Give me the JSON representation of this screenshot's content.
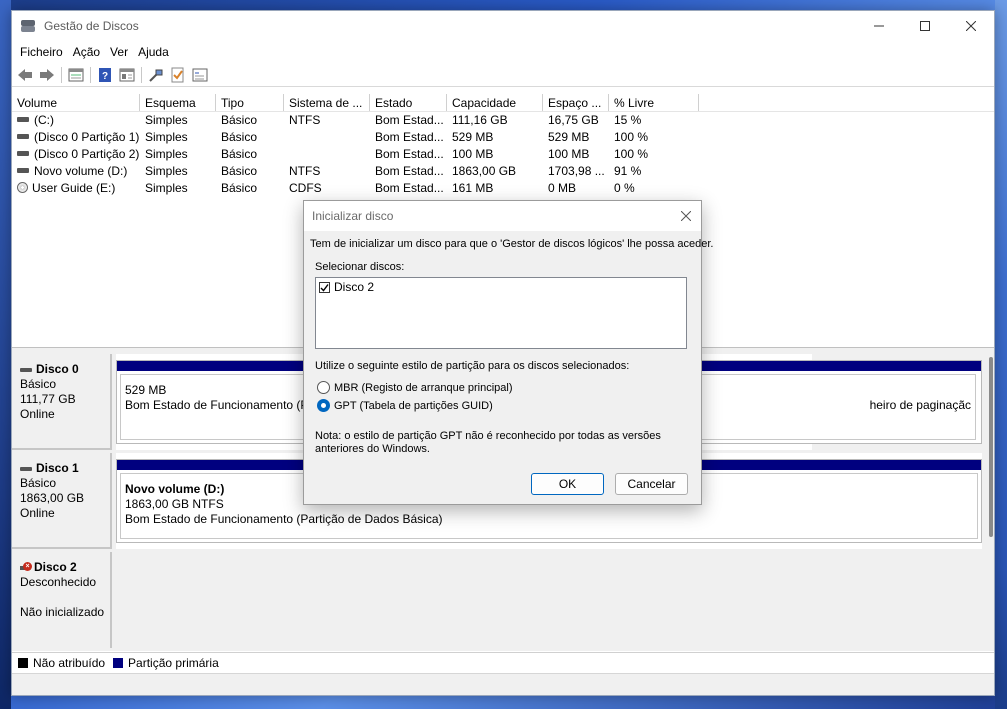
{
  "window": {
    "title": "Gestão de Discos"
  },
  "menu": [
    "Ficheiro",
    "Ação",
    "Ver",
    "Ajuda"
  ],
  "toolbar": {
    "icons": [
      "back-icon",
      "forward-icon",
      "disk-list-icon",
      "help-icon",
      "properties-icon",
      "connect-icon",
      "check-icon",
      "console-icon"
    ]
  },
  "volume_list": {
    "columns": [
      "Volume",
      "Esquema",
      "Tipo",
      "Sistema de ...",
      "Estado",
      "Capacidade",
      "Espaço ...",
      "% Livre"
    ],
    "rows": [
      [
        "(C:)",
        "Simples",
        "Básico",
        "NTFS",
        "Bom Estad...",
        "111,16 GB",
        "16,75 GB",
        "15 %"
      ],
      [
        "(Disco 0 Partição 1)",
        "Simples",
        "Básico",
        "",
        "Bom Estad...",
        "529 MB",
        "529 MB",
        "100 %"
      ],
      [
        "(Disco 0 Partição 2)",
        "Simples",
        "Básico",
        "",
        "Bom Estad...",
        "100 MB",
        "100 MB",
        "100 %"
      ],
      [
        "Novo volume (D:)",
        "Simples",
        "Básico",
        "NTFS",
        "Bom Estad...",
        "1863,00 GB",
        "1703,98 ...",
        "91 %"
      ],
      [
        "User Guide (E:)",
        "Simples",
        "Básico",
        "CDFS",
        "Bom Estad...",
        "161 MB",
        "0 MB",
        "0 %"
      ]
    ]
  },
  "disks": [
    {
      "name": "Disco 0",
      "type": "Básico",
      "size": "111,77 GB",
      "status": "Online",
      "partitions": [
        {
          "line1": "529 MB",
          "line2": "Bom Estado de Funcionamento (P"
        },
        {
          "line1": "",
          "line2": "heiro de paginaçãc"
        }
      ]
    },
    {
      "name": "Disco 1",
      "type": "Básico",
      "size": "1863,00 GB",
      "status": "Online",
      "partitions": [
        {
          "title": "Novo volume  (D:)",
          "line1": "1863,00 GB NTFS",
          "line2": "Bom Estado de Funcionamento (Partição de Dados Básica)"
        }
      ]
    },
    {
      "name": "Disco 2",
      "type": "Desconhecido",
      "size": "",
      "status": "Não inicializado",
      "partitions": []
    }
  ],
  "legend": [
    {
      "label": "Não atribuído",
      "color": "#000000"
    },
    {
      "label": "Partição primária",
      "color": "#00007f"
    }
  ],
  "dialog": {
    "title": "Inicializar disco",
    "intro": "Tem de inicializar um disco para que o 'Gestor de discos lógicos' lhe possa aceder.",
    "select_label": "Selecionar discos:",
    "disks": [
      {
        "label": "Disco 2",
        "checked": true
      }
    ],
    "style_label": "Utilize o seguinte estilo de partição para os discos selecionados:",
    "options": [
      {
        "label": "MBR (Registo de arranque principal)",
        "selected": false
      },
      {
        "label": "GPT (Tabela de partições GUID)",
        "selected": true
      }
    ],
    "note": "Nota: o estilo de partição GPT não é reconhecido por todas as versões anteriores do Windows.",
    "ok_label": "OK",
    "cancel_label": "Cancelar"
  },
  "colors": {
    "primary_partition": "#00007f",
    "accent": "#0067c0",
    "error": "#c42b1c"
  }
}
